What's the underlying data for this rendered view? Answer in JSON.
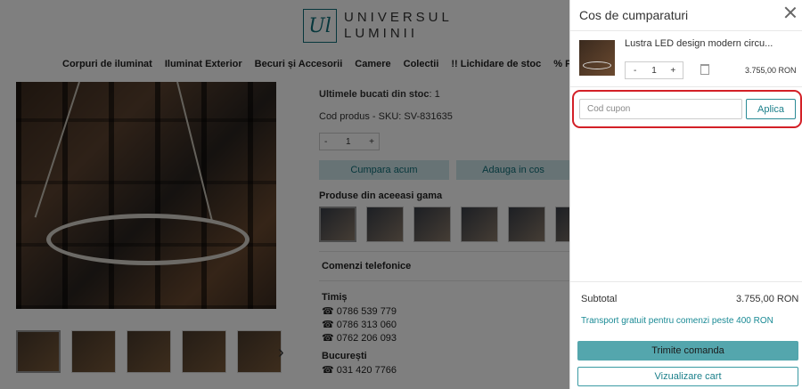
{
  "store": {
    "logo_mark": "Ul",
    "logo_line1": "UNIVERSUL",
    "logo_line2": "LUMINII",
    "nav": [
      "Corpuri de iluminat",
      "Iluminat Exterior",
      "Becuri și Accesorii",
      "Camere",
      "Colectii",
      "!! Lichidare de stoc",
      "% Promotii"
    ],
    "stock_label": "Ultimele bucati din stoc",
    "stock_value": ": 1",
    "sku_text": "Cod produs - SKU: SV-831635",
    "qty_minus": "-",
    "qty_value": "1",
    "qty_plus": "+",
    "buy_now": "Cumpara acum",
    "add_to_cart": "Adauga in cos",
    "gama_title": "Produse din aceeasi gama",
    "phone_orders": "Comenzi telefonice",
    "city1": "Timiș",
    "phones1": [
      "☎ 0786 539 779",
      "☎ 0786 313 060",
      "☎ 0762 206 093"
    ],
    "city2": "București",
    "phones2": [
      "☎ 031 420 7766"
    ],
    "thumb_next": "›"
  },
  "cart": {
    "title": "Cos de cumparaturi",
    "item": {
      "name": "Lustra LED design modern circu...",
      "qty_minus": "-",
      "qty": "1",
      "qty_plus": "+",
      "price": "3.755,00 RON"
    },
    "coupon": {
      "placeholder": "Cod cupon",
      "value": "",
      "apply_label": "Aplica"
    },
    "subtotal_label": "Subtotal",
    "subtotal_value": "3.755,00 RON",
    "shipping_text": "Transport gratuit pentru comenzi peste 400 RON",
    "send_order": "Trimite comanda",
    "view_cart": "Vizualizare cart"
  },
  "colors": {
    "accent": "#1a7f8a",
    "highlight": "#d32027",
    "primary_button": "#54a6ad"
  }
}
